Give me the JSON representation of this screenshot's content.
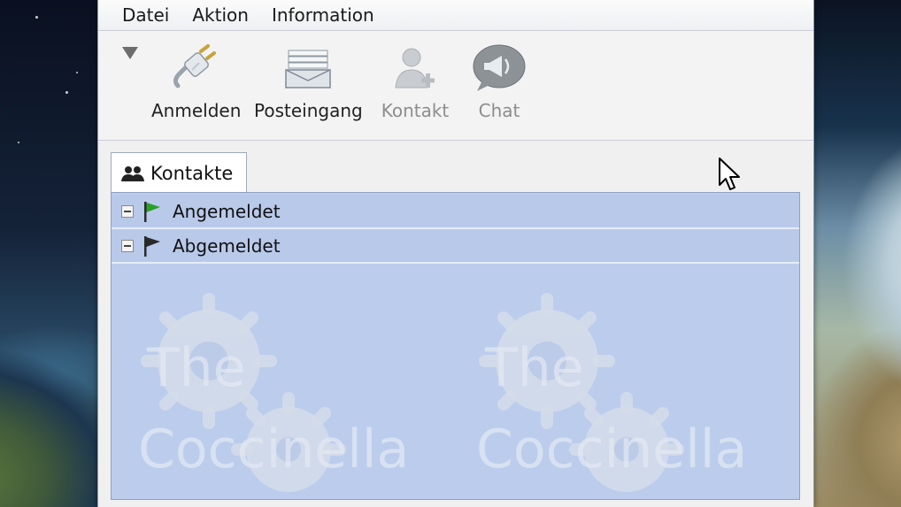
{
  "menu": {
    "items": [
      "Datei",
      "Aktion",
      "Information"
    ]
  },
  "toolbar": {
    "buttons": [
      {
        "label": "Anmelden",
        "icon": "plug-icon",
        "enabled": true
      },
      {
        "label": "Posteingang",
        "icon": "inbox-icon",
        "enabled": true
      },
      {
        "label": "Kontakt",
        "icon": "add-contact-icon",
        "enabled": false
      },
      {
        "label": "Chat",
        "icon": "chat-megaphone-icon",
        "enabled": false
      }
    ]
  },
  "tabs": [
    {
      "label": "Kontakte",
      "icon": "contacts-icon",
      "active": true
    }
  ],
  "tree": {
    "groups": [
      {
        "label": "Angemeldet",
        "icon": "green-flag-icon",
        "flag_color": "#2aa02a",
        "expanded": true
      },
      {
        "label": "Abgemeldet",
        "icon": "black-flag-icon",
        "flag_color": "#2a2a2a",
        "expanded": true
      }
    ]
  },
  "watermark": {
    "text_line1": "The",
    "text_line2": "Coccinella"
  },
  "colors": {
    "tree_background": "#bcccec",
    "window_background": "#f0f0f0",
    "disabled_text": "#8d8d8d"
  }
}
